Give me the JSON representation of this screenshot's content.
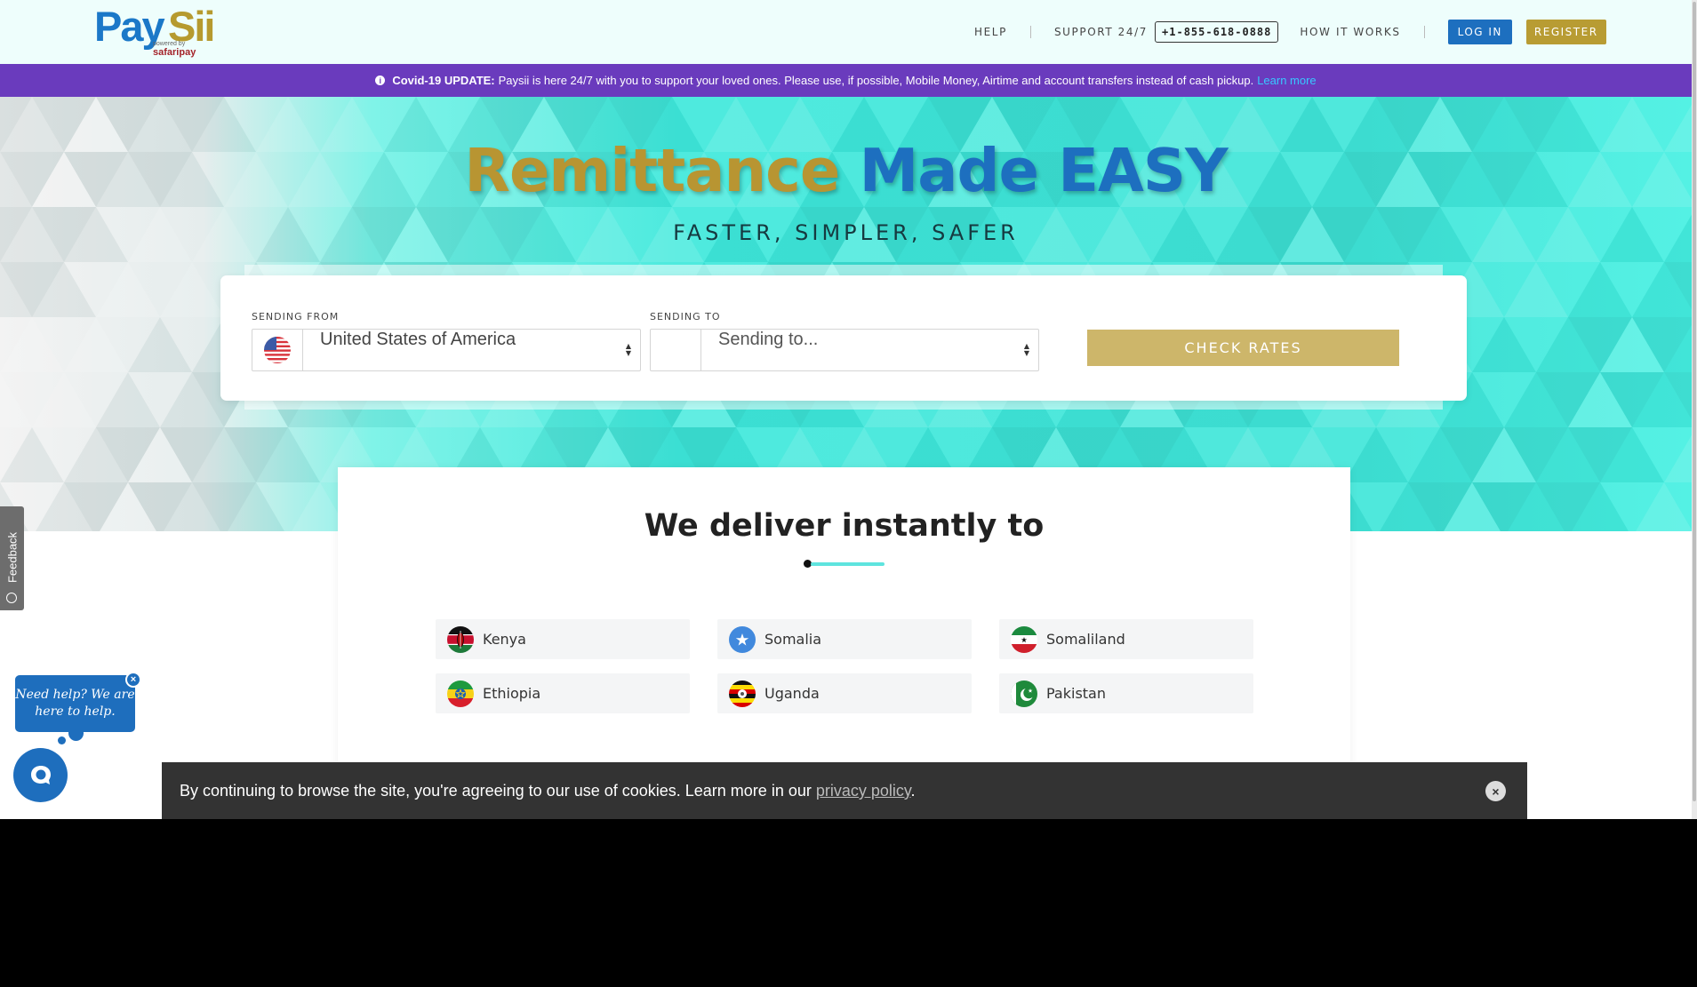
{
  "header": {
    "logo": {
      "pay": "Pay",
      "sii": "Sii",
      "powered": "powered by",
      "safaripay": "safaripay"
    },
    "nav": {
      "help": "HELP",
      "support": "SUPPORT 24/7",
      "phone": "+1-855-618-0888",
      "how_it_works": "HOW IT WORKS",
      "login": "LOG IN",
      "register": "REGISTER"
    }
  },
  "banner": {
    "title": "Covid-19 UPDATE:",
    "text": "Paysii is here 24/7 with you to support your loved ones. Please use, if possible, Mobile Money, Airtime and account transfers instead of cash pickup.",
    "link": "Learn more",
    "icon": "info-icon"
  },
  "hero": {
    "title_part1": "Remittance",
    "title_part2": "Made EASY",
    "subtitle": "FASTER, SIMPLER, SAFER"
  },
  "form": {
    "from_label": "SENDING FROM",
    "from_value": "United States of America",
    "to_label": "SENDING TO",
    "to_placeholder": "Sending to...",
    "button": "CHECK RATES"
  },
  "deliver": {
    "title": "We deliver instantly to",
    "countries": [
      {
        "name": "Kenya"
      },
      {
        "name": "Somalia"
      },
      {
        "name": "Somaliland"
      },
      {
        "name": "Ethiopia"
      },
      {
        "name": "Uganda"
      },
      {
        "name": "Pakistan"
      }
    ]
  },
  "feedback": {
    "label": "Feedback"
  },
  "help": {
    "line1": "Need help? We are",
    "line2": "here to help.",
    "close": "×"
  },
  "cookie": {
    "text": "By continuing to browse the site, you're agreeing to our use of cookies. Learn more in our ",
    "link": "privacy policy",
    "end": ".",
    "close": "×"
  },
  "colors": {
    "brand_blue": "#1d6fbf",
    "brand_gold": "#b89c33",
    "banner": "#6a3bbd",
    "teal": "#40e6d9"
  }
}
